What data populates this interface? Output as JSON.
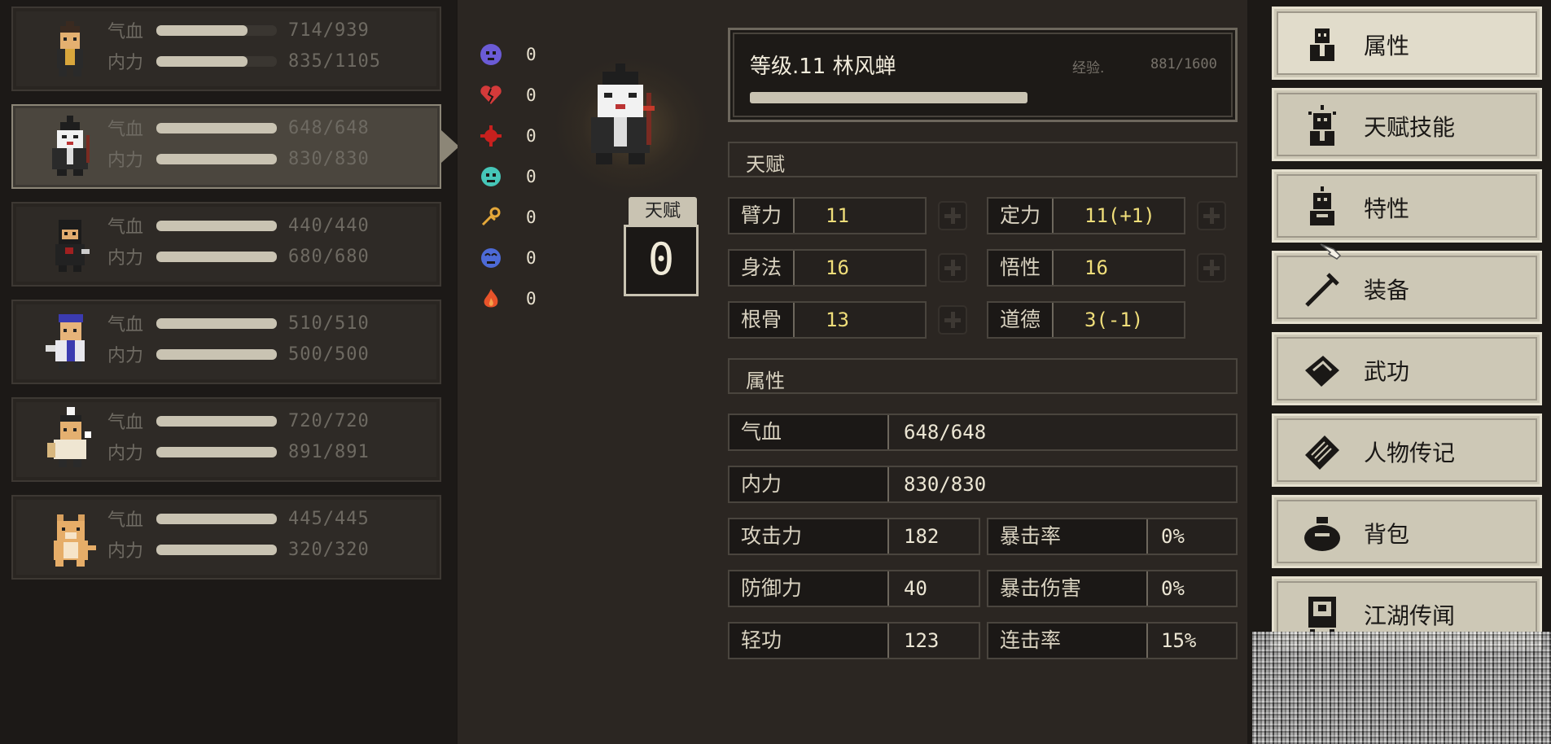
{
  "party": [
    {
      "hp_label": "气血",
      "mp_label": "内力",
      "hp": "714/939",
      "mp": "835/1105",
      "hp_frac": 0.76,
      "mp_frac": 0.76,
      "selected": false
    },
    {
      "hp_label": "气血",
      "mp_label": "内力",
      "hp": "648/648",
      "mp": "830/830",
      "hp_frac": 1.0,
      "mp_frac": 1.0,
      "selected": true
    },
    {
      "hp_label": "气血",
      "mp_label": "内力",
      "hp": "440/440",
      "mp": "680/680",
      "hp_frac": 1.0,
      "mp_frac": 1.0,
      "selected": false
    },
    {
      "hp_label": "气血",
      "mp_label": "内力",
      "hp": "510/510",
      "mp": "500/500",
      "hp_frac": 1.0,
      "mp_frac": 1.0,
      "selected": false
    },
    {
      "hp_label": "气血",
      "mp_label": "内力",
      "hp": "720/720",
      "mp": "891/891",
      "hp_frac": 1.0,
      "mp_frac": 1.0,
      "selected": false
    },
    {
      "hp_label": "气血",
      "mp_label": "内力",
      "hp": "445/445",
      "mp": "320/320",
      "hp_frac": 1.0,
      "mp_frac": 1.0,
      "selected": false
    }
  ],
  "status_effects": [
    {
      "icon": "skull-icon",
      "color": "#6b5bd6",
      "value": "0"
    },
    {
      "icon": "broken-heart-icon",
      "color": "#d43a3a",
      "value": "0"
    },
    {
      "icon": "blood-splat-icon",
      "color": "#c8201e",
      "value": "0"
    },
    {
      "icon": "poison-icon",
      "color": "#46c6b8",
      "value": "0"
    },
    {
      "icon": "dizzy-icon",
      "color": "#e5a83a",
      "value": "0"
    },
    {
      "icon": "confused-face-icon",
      "color": "#4d6ad6",
      "value": "0"
    },
    {
      "icon": "fire-icon",
      "color": "#e8532a",
      "value": "0"
    }
  ],
  "talent": {
    "label": "天赋",
    "value": "0"
  },
  "header": {
    "level_name": "等级.11 林风蝉",
    "exp_label": "经验.",
    "exp_value": "881/1600",
    "exp_frac": 0.55
  },
  "sections": {
    "talent": "天赋",
    "attributes": "属性"
  },
  "talent_stats": [
    {
      "name": "臂力",
      "value": "11"
    },
    {
      "name": "定力",
      "value": "11(+1)"
    },
    {
      "name": "身法",
      "value": "16"
    },
    {
      "name": "悟性",
      "value": "16"
    },
    {
      "name": "根骨",
      "value": "13"
    },
    {
      "name": "道德",
      "value": "3(-1)"
    }
  ],
  "attributes": {
    "hp": {
      "name": "气血",
      "value": "648/648"
    },
    "mp": {
      "name": "内力",
      "value": "830/830"
    },
    "grid": [
      {
        "name": "攻击力",
        "value": "182"
      },
      {
        "name": "暴击率",
        "value": "0%"
      },
      {
        "name": "防御力",
        "value": "40"
      },
      {
        "name": "暴击伤害",
        "value": "0%"
      },
      {
        "name": "轻功",
        "value": "123"
      },
      {
        "name": "连击率",
        "value": "15%"
      }
    ]
  },
  "menu": [
    {
      "label": "属性",
      "icon": "character-icon",
      "active": true
    },
    {
      "label": "天赋技能",
      "icon": "talent-character-icon",
      "active": false
    },
    {
      "label": "特性",
      "icon": "trait-character-icon",
      "active": false
    },
    {
      "label": "装备",
      "icon": "sword-icon",
      "active": false
    },
    {
      "label": "武功",
      "icon": "book-icon",
      "active": false
    },
    {
      "label": "人物传记",
      "icon": "scroll-icon",
      "active": false
    },
    {
      "label": "背包",
      "icon": "bag-icon",
      "active": false
    },
    {
      "label": "江湖传闻",
      "icon": "notice-board-icon",
      "active": false
    }
  ]
}
